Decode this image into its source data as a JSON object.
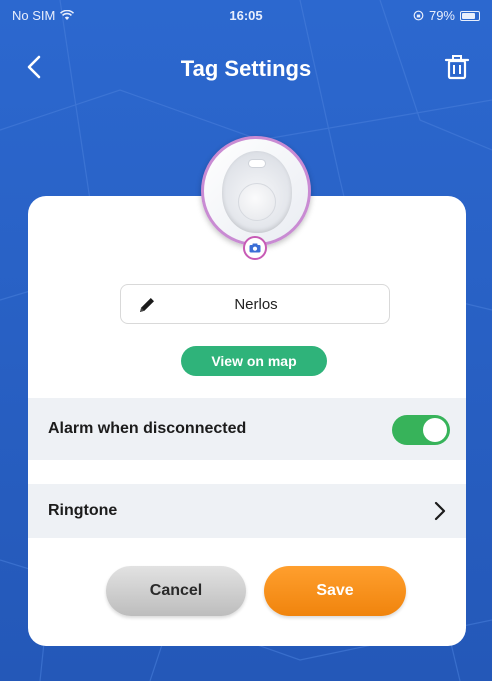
{
  "status_bar": {
    "carrier": "No SIM",
    "time": "16:05",
    "battery_percent": "79%",
    "battery_level": 0.79,
    "icons": [
      "wifi-icon",
      "orientation-lock-icon",
      "battery-icon"
    ]
  },
  "nav": {
    "title": "Tag Settings",
    "icons": [
      "chevron-left-icon",
      "trash-icon"
    ]
  },
  "tag": {
    "name": "Nerlos",
    "icons": [
      "camera-icon",
      "pencil-icon"
    ]
  },
  "actions": {
    "view_on_map": "View on map"
  },
  "settings": {
    "alarm_label": "Alarm when disconnected",
    "alarm_enabled": true,
    "ringtone_label": "Ringtone"
  },
  "buttons": {
    "cancel": "Cancel",
    "save": "Save"
  },
  "colors": {
    "background": "#2c68cf",
    "map_button": "#2fb37a",
    "toggle_on": "#37b35a",
    "save_button": "#f0840d",
    "avatar_ring": "#c98bd3"
  }
}
